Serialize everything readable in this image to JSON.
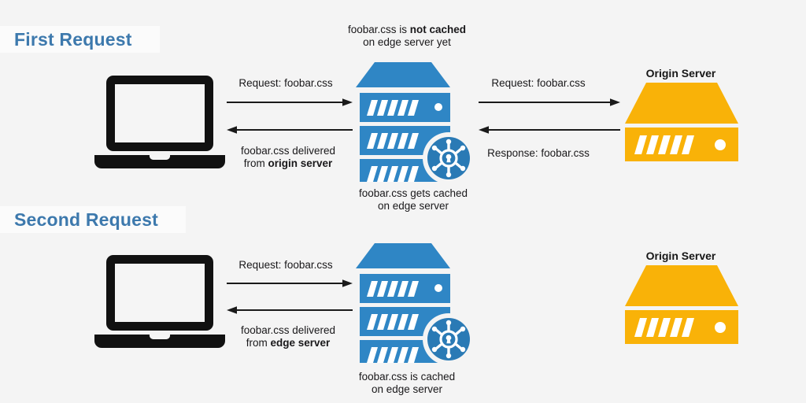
{
  "diagram": {
    "title_first": "First Request",
    "title_second": "Second Request",
    "colors": {
      "background": "#f4f4f4",
      "heading_text": "#3d79ad",
      "heading_chip_bg": "#fbfbfb",
      "edge_server_blue": "#2f86c5",
      "origin_server_orange": "#f9b208",
      "laptop_black": "#111111",
      "arrow_black": "#1a1a1a",
      "caption_text": "#19181a"
    }
  },
  "first_request": {
    "client": {
      "name": "laptop"
    },
    "edge_server": {
      "title": "",
      "note_above_line1": "foobar.css is ",
      "note_above_bold": "not cached",
      "note_above_line2": "on edge server yet",
      "note_below_line1": "foobar.css gets cached",
      "note_below_line2": "on edge server"
    },
    "origin_server": {
      "title": "Origin Server"
    },
    "arrows": {
      "client_to_edge": "Request: foobar.css",
      "edge_to_client_line1": "foobar.css delivered",
      "edge_to_client_line2_prefix": "from ",
      "edge_to_client_line2_bold": "origin server",
      "edge_to_origin": "Request: foobar.css",
      "origin_to_edge": "Response: foobar.css"
    }
  },
  "second_request": {
    "client": {
      "name": "laptop"
    },
    "edge_server": {
      "note_below_line1": "foobar.css is cached",
      "note_below_line2": "on edge server"
    },
    "origin_server": {
      "title": "Origin Server"
    },
    "arrows": {
      "client_to_edge": "Request: foobar.css",
      "edge_to_client_line1": "foobar.css delivered",
      "edge_to_client_line2_prefix": "from ",
      "edge_to_client_line2_bold": "edge server"
    }
  }
}
